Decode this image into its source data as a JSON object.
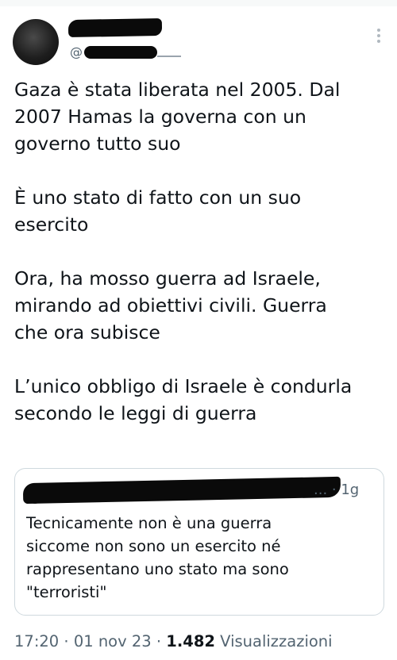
{
  "author": {
    "handle_prefix": "@"
  },
  "tweet": {
    "paragraphs": [
      "Gaza è stata liberata nel 2005. Dal\n2007 Hamas la governa con un\ngoverno tutto suo",
      "È uno stato di fatto con un suo\nesercito",
      "Ora, ha mosso guerra ad Israele,\nmirando ad obiettivi civili. Guerra\nche ora subisce",
      "L’unico obbligo di Israele è condurla\nsecondo le leggi di guerra"
    ]
  },
  "quote": {
    "meta": "... · 1g",
    "text": "Tecnicamente non è una guerra\nsiccome non sono un esercito né\nrappresentano uno stato ma sono\n\"terroristi\""
  },
  "footer": {
    "time": "17:20",
    "separator1": " · ",
    "date": "01 nov 23",
    "separator2": " · ",
    "views_count": "1.482",
    "views_label": " Visualizzazioni"
  },
  "icons": {
    "more": "more-vertical-icon"
  }
}
